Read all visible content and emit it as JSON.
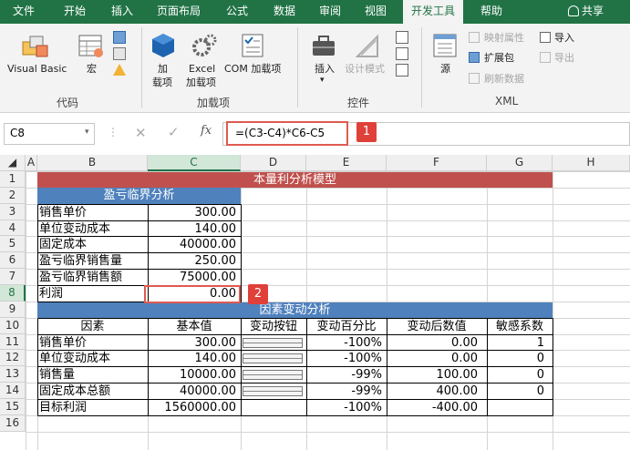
{
  "tabs": [
    "文件",
    "开始",
    "插入",
    "页面布局",
    "公式",
    "数据",
    "审阅",
    "视图",
    "开发工具",
    "帮助"
  ],
  "share": "共享",
  "ribbon": {
    "visual_basic": "Visual Basic",
    "macro": "宏",
    "group_code": "代码",
    "addin_l1": "加",
    "addin_l2": "载项",
    "excel_addin_l1": "Excel",
    "excel_addin_l2": "加载项",
    "com_addin": "COM 加载项",
    "group_addins": "加载项",
    "insert": "插入",
    "design_mode": "设计模式",
    "group_controls": "控件",
    "source": "源",
    "map_props": "映射属性",
    "expansion": "扩展包",
    "refresh": "刷新数据",
    "import": "导入",
    "export": "导出",
    "group_xml": "XML"
  },
  "formula_bar": {
    "name_box": "C8",
    "fx": "fx",
    "formula": "=(C3-C4)*C6-C5"
  },
  "callouts": [
    "1",
    "2"
  ],
  "columns": [
    "A",
    "B",
    "C",
    "D",
    "E",
    "F",
    "G",
    "H"
  ],
  "rows": [
    "1",
    "2",
    "3",
    "4",
    "5",
    "6",
    "7",
    "8",
    "9",
    "10",
    "11",
    "12",
    "13",
    "14",
    "15",
    "16"
  ],
  "sheet": {
    "title": "本量利分析模型",
    "bep_header": "盈亏临界分析",
    "bep_rows": [
      [
        "销售单价",
        "300.00"
      ],
      [
        "单位变动成本",
        "140.00"
      ],
      [
        "固定成本",
        "40000.00"
      ],
      [
        "盈亏临界销售量",
        "250.00"
      ],
      [
        "盈亏临界销售额",
        "75000.00"
      ],
      [
        "利润",
        "0.00"
      ]
    ],
    "factor_header": "因素变动分析",
    "factor_cols": [
      "因素",
      "基本值",
      "变动按钮",
      "变动百分比",
      "变动后数值",
      "敏感系数"
    ],
    "factor_rows": [
      [
        "销售单价",
        "300.00",
        "-100%",
        "0.00",
        "1"
      ],
      [
        "单位变动成本",
        "140.00",
        "-100%",
        "0.00",
        "0"
      ],
      [
        "销售量",
        "10000.00",
        "-99%",
        "100.00",
        "0"
      ],
      [
        "固定成本总额",
        "40000.00",
        "-99%",
        "400.00",
        "0"
      ],
      [
        "目标利润",
        "1560000.00",
        "-100%",
        "-400.00",
        ""
      ]
    ]
  },
  "colors": {
    "excel_green": "#217346",
    "title_red": "#c0504d",
    "header_blue": "#4f81bd",
    "callout_red": "#e0403a",
    "highlight": "#e05a50"
  }
}
